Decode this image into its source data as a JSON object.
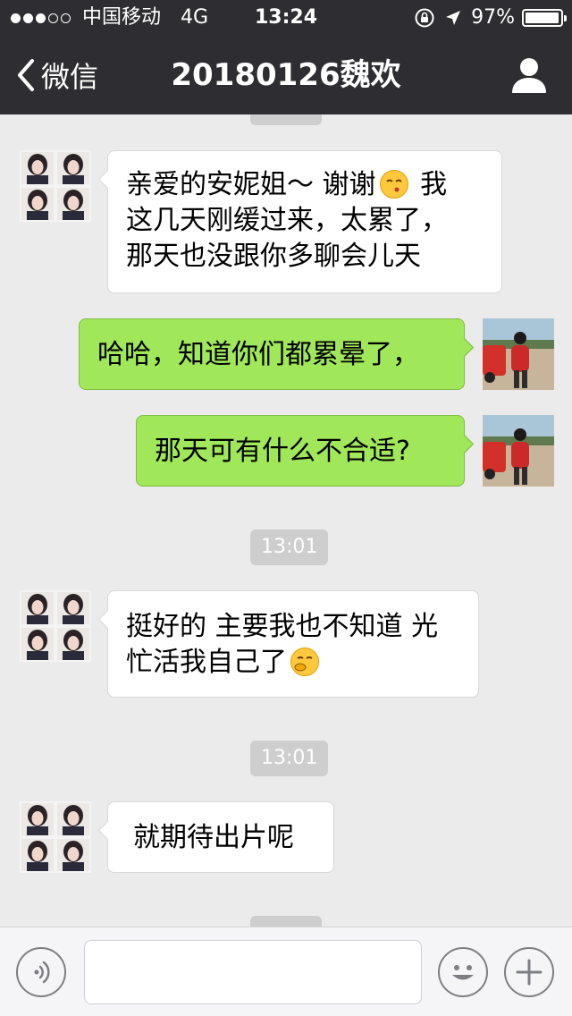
{
  "status_bar": {
    "carrier": "中国移动",
    "network": "4G",
    "time": "13:24",
    "battery_percent": "97%",
    "battery_level": 0.97,
    "signal_bars_filled": 3,
    "signal_bars_total": 5
  },
  "nav": {
    "back_label": "微信",
    "title": "20180126魏欢"
  },
  "messages": [
    {
      "side": "in",
      "text_parts": [
        "亲爱的安妮姐～ 谢谢",
        "emoji:kiss",
        " 我",
        "\n",
        "这几天刚缓过来，太累了，",
        "\n",
        "那天也没跟你多聊会儿天"
      ]
    },
    {
      "side": "out",
      "text": "哈哈，知道你们都累晕了，"
    },
    {
      "side": "out",
      "text": "那天可有什么不合适?"
    },
    {
      "timestamp": "13:01"
    },
    {
      "side": "in",
      "text_parts": [
        "挺好的 主要我也不知道 光",
        "\n",
        "忙活我自己了",
        "emoji:hmm"
      ]
    },
    {
      "timestamp": "13:01"
    },
    {
      "side": "in",
      "text": "就期待出片呢"
    }
  ],
  "msg1": {
    "line1": "亲爱的安妮姐～ 谢谢",
    "line1_end": " 我",
    "line2": "这几天刚缓过来，太累了，",
    "line3": "那天也没跟你多聊会儿天"
  },
  "msg2": {
    "text": "哈哈，知道你们都累晕了，"
  },
  "msg3": {
    "text": "那天可有什么不合适?"
  },
  "time1": {
    "text": "13:01"
  },
  "msg4": {
    "line1": "挺好的 主要我也不知道 光",
    "line2": "忙活我自己了"
  },
  "time2": {
    "text": "13:01"
  },
  "msg5": {
    "text": "就期待出片呢"
  },
  "input": {
    "value": "",
    "placeholder": ""
  },
  "icons": {
    "back": "chevron-left-icon",
    "profile": "person-icon",
    "voice": "voice-icon",
    "emoji": "smiley-icon",
    "plus": "plus-icon",
    "lock": "rotation-lock-icon",
    "location": "location-arrow-icon",
    "emoji_in_msg1": "kiss-emoji-icon",
    "emoji_in_msg4": "thinking-emoji-icon"
  },
  "colors": {
    "nav_bg": "#2e2e32",
    "chat_bg": "#ebebeb",
    "out_bubble": "#a0e75a",
    "in_bubble": "#ffffff",
    "timestamp_bg": "#cecece"
  }
}
